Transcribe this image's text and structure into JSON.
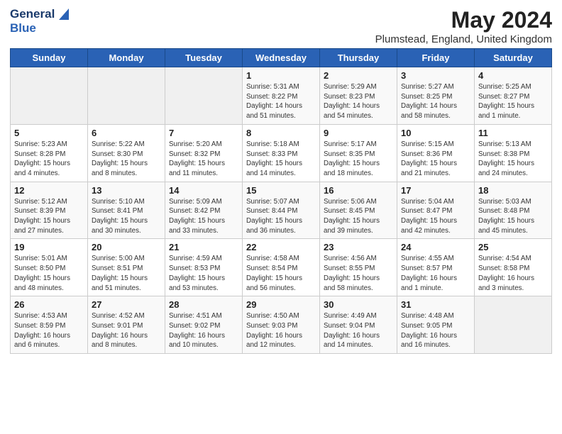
{
  "header": {
    "logo_line1": "General",
    "logo_line2": "Blue",
    "title": "May 2024",
    "subtitle": "Plumstead, England, United Kingdom"
  },
  "weekdays": [
    "Sunday",
    "Monday",
    "Tuesday",
    "Wednesday",
    "Thursday",
    "Friday",
    "Saturday"
  ],
  "weeks": [
    [
      {
        "day": "",
        "info": ""
      },
      {
        "day": "",
        "info": ""
      },
      {
        "day": "",
        "info": ""
      },
      {
        "day": "1",
        "info": "Sunrise: 5:31 AM\nSunset: 8:22 PM\nDaylight: 14 hours\nand 51 minutes."
      },
      {
        "day": "2",
        "info": "Sunrise: 5:29 AM\nSunset: 8:23 PM\nDaylight: 14 hours\nand 54 minutes."
      },
      {
        "day": "3",
        "info": "Sunrise: 5:27 AM\nSunset: 8:25 PM\nDaylight: 14 hours\nand 58 minutes."
      },
      {
        "day": "4",
        "info": "Sunrise: 5:25 AM\nSunset: 8:27 PM\nDaylight: 15 hours\nand 1 minute."
      }
    ],
    [
      {
        "day": "5",
        "info": "Sunrise: 5:23 AM\nSunset: 8:28 PM\nDaylight: 15 hours\nand 4 minutes."
      },
      {
        "day": "6",
        "info": "Sunrise: 5:22 AM\nSunset: 8:30 PM\nDaylight: 15 hours\nand 8 minutes."
      },
      {
        "day": "7",
        "info": "Sunrise: 5:20 AM\nSunset: 8:32 PM\nDaylight: 15 hours\nand 11 minutes."
      },
      {
        "day": "8",
        "info": "Sunrise: 5:18 AM\nSunset: 8:33 PM\nDaylight: 15 hours\nand 14 minutes."
      },
      {
        "day": "9",
        "info": "Sunrise: 5:17 AM\nSunset: 8:35 PM\nDaylight: 15 hours\nand 18 minutes."
      },
      {
        "day": "10",
        "info": "Sunrise: 5:15 AM\nSunset: 8:36 PM\nDaylight: 15 hours\nand 21 minutes."
      },
      {
        "day": "11",
        "info": "Sunrise: 5:13 AM\nSunset: 8:38 PM\nDaylight: 15 hours\nand 24 minutes."
      }
    ],
    [
      {
        "day": "12",
        "info": "Sunrise: 5:12 AM\nSunset: 8:39 PM\nDaylight: 15 hours\nand 27 minutes."
      },
      {
        "day": "13",
        "info": "Sunrise: 5:10 AM\nSunset: 8:41 PM\nDaylight: 15 hours\nand 30 minutes."
      },
      {
        "day": "14",
        "info": "Sunrise: 5:09 AM\nSunset: 8:42 PM\nDaylight: 15 hours\nand 33 minutes."
      },
      {
        "day": "15",
        "info": "Sunrise: 5:07 AM\nSunset: 8:44 PM\nDaylight: 15 hours\nand 36 minutes."
      },
      {
        "day": "16",
        "info": "Sunrise: 5:06 AM\nSunset: 8:45 PM\nDaylight: 15 hours\nand 39 minutes."
      },
      {
        "day": "17",
        "info": "Sunrise: 5:04 AM\nSunset: 8:47 PM\nDaylight: 15 hours\nand 42 minutes."
      },
      {
        "day": "18",
        "info": "Sunrise: 5:03 AM\nSunset: 8:48 PM\nDaylight: 15 hours\nand 45 minutes."
      }
    ],
    [
      {
        "day": "19",
        "info": "Sunrise: 5:01 AM\nSunset: 8:50 PM\nDaylight: 15 hours\nand 48 minutes."
      },
      {
        "day": "20",
        "info": "Sunrise: 5:00 AM\nSunset: 8:51 PM\nDaylight: 15 hours\nand 51 minutes."
      },
      {
        "day": "21",
        "info": "Sunrise: 4:59 AM\nSunset: 8:53 PM\nDaylight: 15 hours\nand 53 minutes."
      },
      {
        "day": "22",
        "info": "Sunrise: 4:58 AM\nSunset: 8:54 PM\nDaylight: 15 hours\nand 56 minutes."
      },
      {
        "day": "23",
        "info": "Sunrise: 4:56 AM\nSunset: 8:55 PM\nDaylight: 15 hours\nand 58 minutes."
      },
      {
        "day": "24",
        "info": "Sunrise: 4:55 AM\nSunset: 8:57 PM\nDaylight: 16 hours\nand 1 minute."
      },
      {
        "day": "25",
        "info": "Sunrise: 4:54 AM\nSunset: 8:58 PM\nDaylight: 16 hours\nand 3 minutes."
      }
    ],
    [
      {
        "day": "26",
        "info": "Sunrise: 4:53 AM\nSunset: 8:59 PM\nDaylight: 16 hours\nand 6 minutes."
      },
      {
        "day": "27",
        "info": "Sunrise: 4:52 AM\nSunset: 9:01 PM\nDaylight: 16 hours\nand 8 minutes."
      },
      {
        "day": "28",
        "info": "Sunrise: 4:51 AM\nSunset: 9:02 PM\nDaylight: 16 hours\nand 10 minutes."
      },
      {
        "day": "29",
        "info": "Sunrise: 4:50 AM\nSunset: 9:03 PM\nDaylight: 16 hours\nand 12 minutes."
      },
      {
        "day": "30",
        "info": "Sunrise: 4:49 AM\nSunset: 9:04 PM\nDaylight: 16 hours\nand 14 minutes."
      },
      {
        "day": "31",
        "info": "Sunrise: 4:48 AM\nSunset: 9:05 PM\nDaylight: 16 hours\nand 16 minutes."
      },
      {
        "day": "",
        "info": ""
      }
    ]
  ]
}
